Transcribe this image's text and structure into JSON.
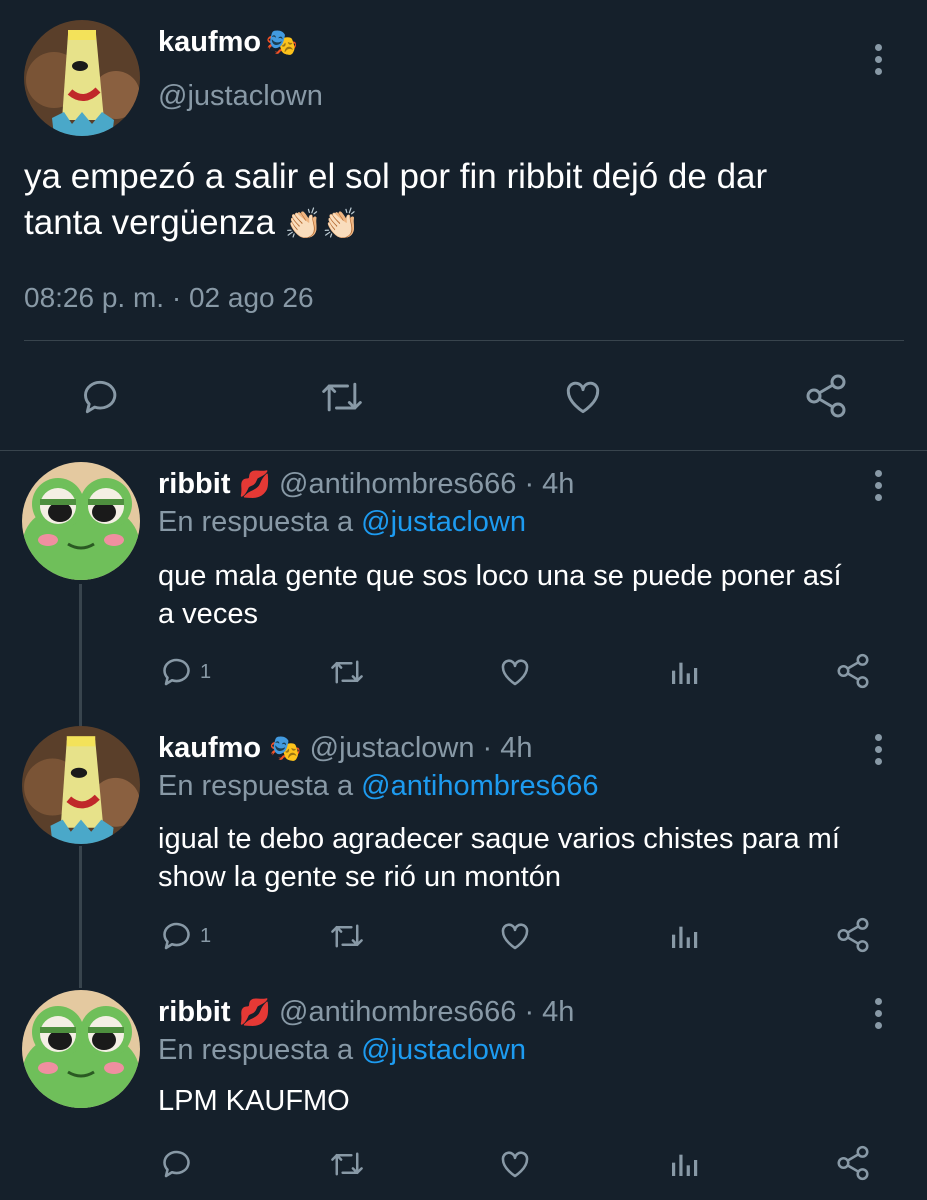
{
  "main_tweet": {
    "author_name": "kaufmo",
    "author_emoji": "🎭",
    "author_handle": "@justaclown",
    "text_line1": "ya empezó a salir el sol por fin ribbit dejó de dar",
    "text_line2": "tanta vergüenza",
    "text_emoji": "👏🏻👏🏻",
    "timestamp": "08:26 p. m. · 02 ago 26",
    "actions": [
      "reply-icon",
      "retweet-icon",
      "like-icon",
      "share-icon"
    ]
  },
  "replies": [
    {
      "name": "ribbit",
      "emoji": "💋",
      "handle_time": "@antihombres666 · 4h",
      "reply_prefix": "En respuesta a",
      "reply_to": "@justaclown",
      "text_line1": "que mala gente que sos loco una se puede poner así",
      "text_line2": "a veces",
      "reply_count": "1"
    },
    {
      "name": "kaufmo",
      "emoji": "🎭",
      "handle_time": "@justaclown · 4h",
      "reply_prefix": "En respuesta a",
      "reply_to": "@antihombres666",
      "text_line1": "igual te debo agradecer saque varios chistes para mí",
      "text_line2": "show la gente se rió un montón",
      "reply_count": "1"
    },
    {
      "name": "ribbit",
      "emoji": "💋",
      "handle_time": "@antihombres666 · 4h",
      "reply_prefix": "En respuesta a",
      "reply_to": "@justaclown",
      "text_line1": "LPM KAUFMO",
      "text_line2": "",
      "reply_count": ""
    }
  ],
  "colors": {
    "background": "#15202b",
    "muted": "#8899a6",
    "link": "#1d9bf0",
    "divider": "#38444d"
  }
}
